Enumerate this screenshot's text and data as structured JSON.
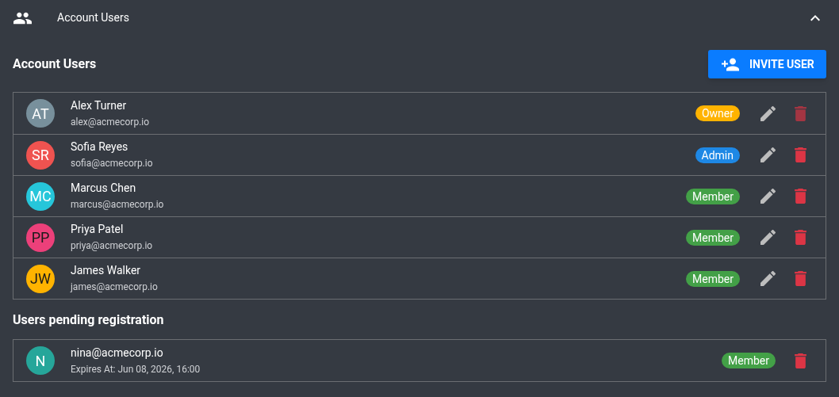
{
  "panel": {
    "title": "Account Users",
    "expanded": true
  },
  "section_title": "Account Users",
  "invite_button": "INVITE USER",
  "users": [
    {
      "avatar": {
        "initials": "AT",
        "color": "#78909c",
        "dark_text": false
      },
      "name": "Alex Turner",
      "email": "alex@acmecorp.io",
      "badge": {
        "text": "Owner",
        "color": "#ffb300"
      },
      "delete_disabled": true
    },
    {
      "avatar": {
        "initials": "SR",
        "color": "#ef5350",
        "dark_text": false
      },
      "name": "Sofia Reyes",
      "email": "sofia@acmecorp.io",
      "badge": {
        "text": "Admin",
        "color": "#1e88e5"
      },
      "delete_disabled": false
    },
    {
      "avatar": {
        "initials": "MC",
        "color": "#26c6da",
        "dark_text": false
      },
      "name": "Marcus Chen",
      "email": "marcus@acmecorp.io",
      "badge": {
        "text": "Member",
        "color": "#43a047"
      },
      "delete_disabled": false
    },
    {
      "avatar": {
        "initials": "PP",
        "color": "#ec407a",
        "dark_text": true
      },
      "name": "Priya Patel",
      "email": "priya@acmecorp.io",
      "badge": {
        "text": "Member",
        "color": "#43a047"
      },
      "delete_disabled": false
    },
    {
      "avatar": {
        "initials": "JW",
        "color": "#ffb300",
        "dark_text": true
      },
      "name": "James Walker",
      "email": "james@acmecorp.io",
      "badge": {
        "text": "Member",
        "color": "#43a047"
      },
      "delete_disabled": false
    }
  ],
  "pending_title": "Users pending registration",
  "pending": [
    {
      "avatar": {
        "initials": "N",
        "color": "#26a69a",
        "dark_text": false
      },
      "email": "nina@acmecorp.io",
      "expires": "Expires At: Jun 08, 2026, 16:00",
      "badge": {
        "text": "Member",
        "color": "#43a047"
      }
    }
  ]
}
